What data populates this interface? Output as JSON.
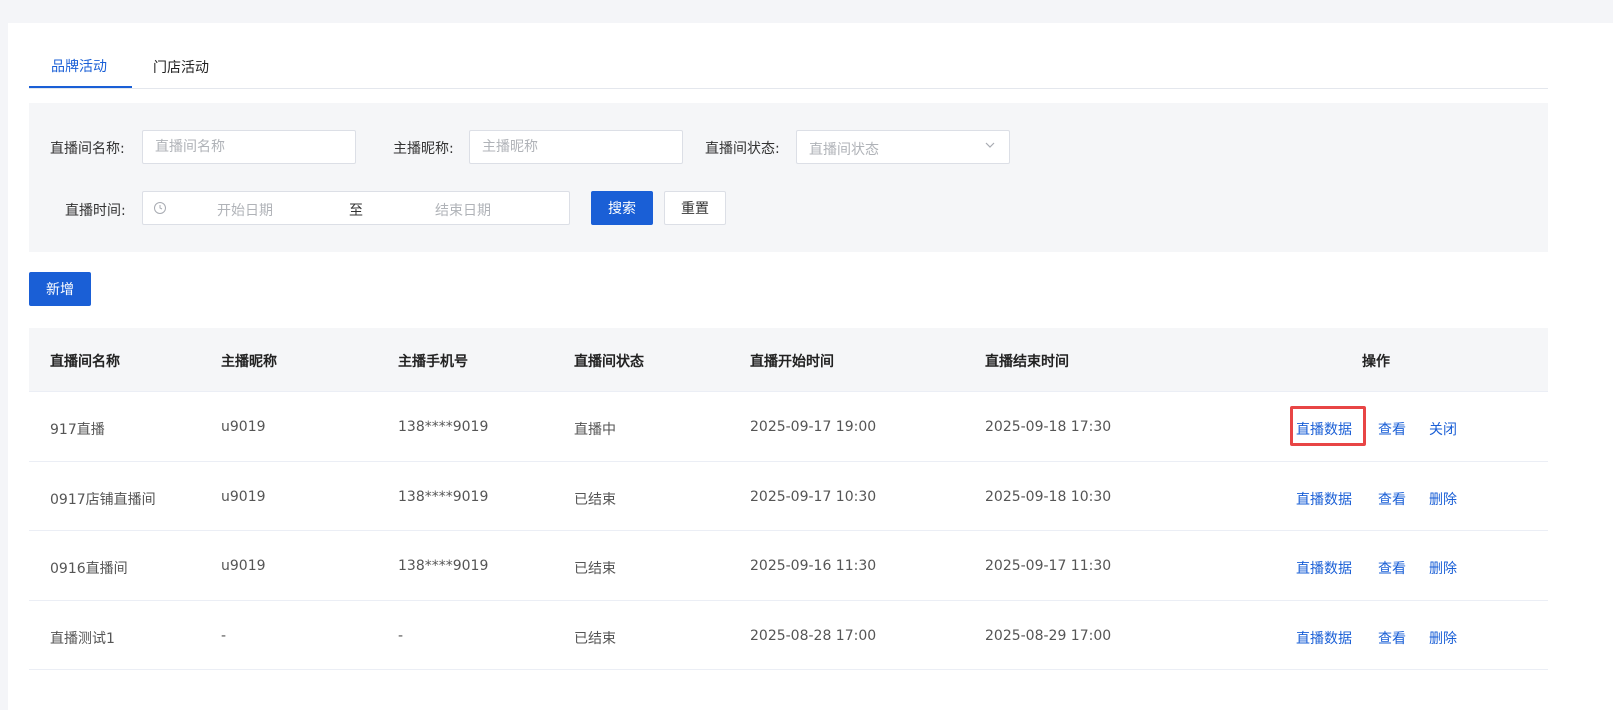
{
  "tabs": [
    {
      "label": "品牌活动",
      "active": true
    },
    {
      "label": "门店活动",
      "active": false
    }
  ],
  "filters": {
    "room_name_label": "直播间名称:",
    "room_name_placeholder": "直播间名称",
    "nickname_label": "主播昵称:",
    "nickname_placeholder": "主播昵称",
    "status_label": "直播间状态:",
    "status_placeholder": "直播间状态",
    "time_label": "直播时间:",
    "start_placeholder": "开始日期",
    "range_separator": "至",
    "end_placeholder": "结束日期",
    "search_label": "搜索",
    "reset_label": "重置"
  },
  "add_label": "新增",
  "table": {
    "headers": [
      "直播间名称",
      "主播昵称",
      "主播手机号",
      "直播间状态",
      "直播开始时间",
      "直播结束时间",
      "操作"
    ],
    "rows": [
      {
        "name": "917直播",
        "nickname": "u9019",
        "phone": "138****9019",
        "status": "直播中",
        "start": "2025-09-17 19:00",
        "end": "2025-09-18 17:30",
        "actions": [
          "直播数据",
          "查看",
          "关闭"
        ]
      },
      {
        "name": "0917店铺直播间",
        "nickname": "u9019",
        "phone": "138****9019",
        "status": "已结束",
        "start": "2025-09-17 10:30",
        "end": "2025-09-18 10:30",
        "actions": [
          "直播数据",
          "查看",
          "删除"
        ]
      },
      {
        "name": "0916直播间",
        "nickname": "u9019",
        "phone": "138****9019",
        "status": "已结束",
        "start": "2025-09-16 11:30",
        "end": "2025-09-17 11:30",
        "actions": [
          "直播数据",
          "查看",
          "删除"
        ]
      },
      {
        "name": "直播测试1",
        "nickname": "-",
        "phone": "-",
        "status": "已结束",
        "start": "2025-08-28 17:00",
        "end": "2025-08-29 17:00",
        "actions": [
          "直播数据",
          "查看",
          "删除"
        ]
      }
    ]
  },
  "colors": {
    "primary": "#1a5fd6",
    "highlight": "#e84545"
  },
  "icons": {
    "date": "clock-icon",
    "select": "chevron-down-icon"
  }
}
